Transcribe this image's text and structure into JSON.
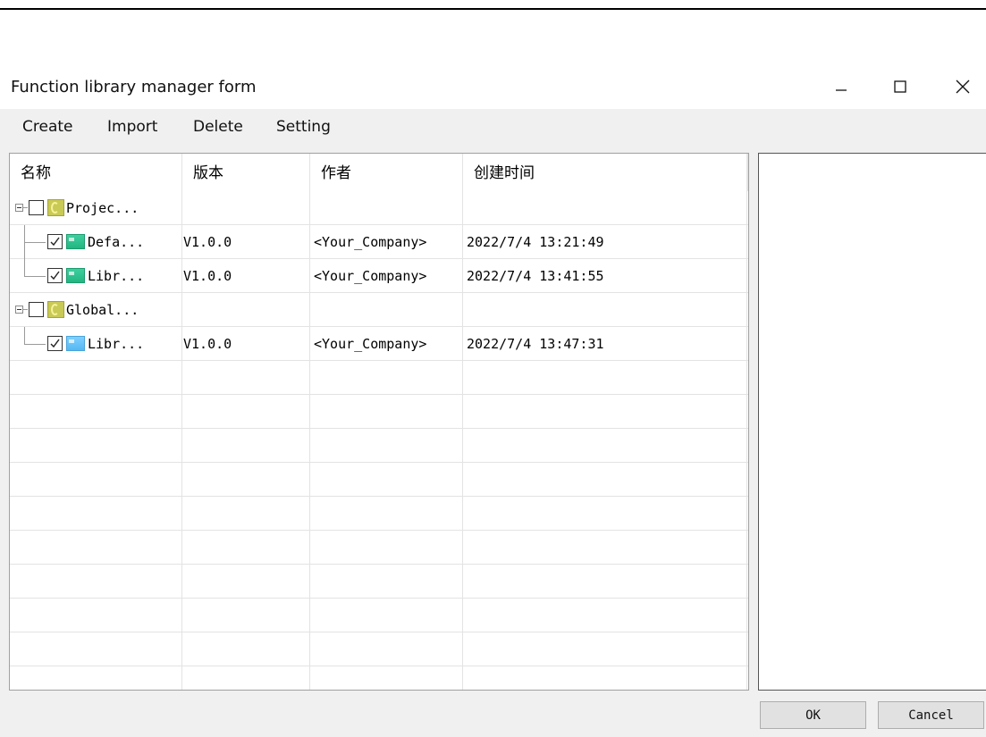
{
  "window": {
    "title": "Function library manager form",
    "controls": {
      "minimize": "minimize-icon",
      "maximize": "maximize-icon",
      "close": "close-icon"
    }
  },
  "menu": {
    "items": [
      "Create",
      "Import",
      "Delete",
      "Setting"
    ]
  },
  "table": {
    "columns": [
      "名称",
      "版本",
      "作者",
      "创建时间"
    ],
    "rows": [
      {
        "type": "group",
        "name": "Projec...",
        "checked": false,
        "icon": "folder-icon",
        "version": "",
        "author": "",
        "created": ""
      },
      {
        "type": "item",
        "name": "Defa...",
        "checked": true,
        "icon": "library-icon",
        "color": "#22b581",
        "version": "V1.0.0",
        "author": "<Your_Company>",
        "created": "2022/7/4 13:21:49"
      },
      {
        "type": "item",
        "name": "Libr...",
        "checked": true,
        "icon": "library-icon",
        "color": "#22b581",
        "version": "V1.0.0",
        "author": "<Your_Company>",
        "created": "2022/7/4 13:41:55"
      },
      {
        "type": "group",
        "name": "Global...",
        "checked": false,
        "icon": "folder-icon",
        "version": "",
        "author": "",
        "created": ""
      },
      {
        "type": "item",
        "name": "Libr...",
        "checked": true,
        "icon": "library-icon",
        "color": "#55b8f2",
        "version": "V1.0.0",
        "author": "<Your_Company>",
        "created": "2022/7/4 13:47:31"
      }
    ]
  },
  "buttons": {
    "ok": "OK",
    "cancel": "Cancel"
  }
}
